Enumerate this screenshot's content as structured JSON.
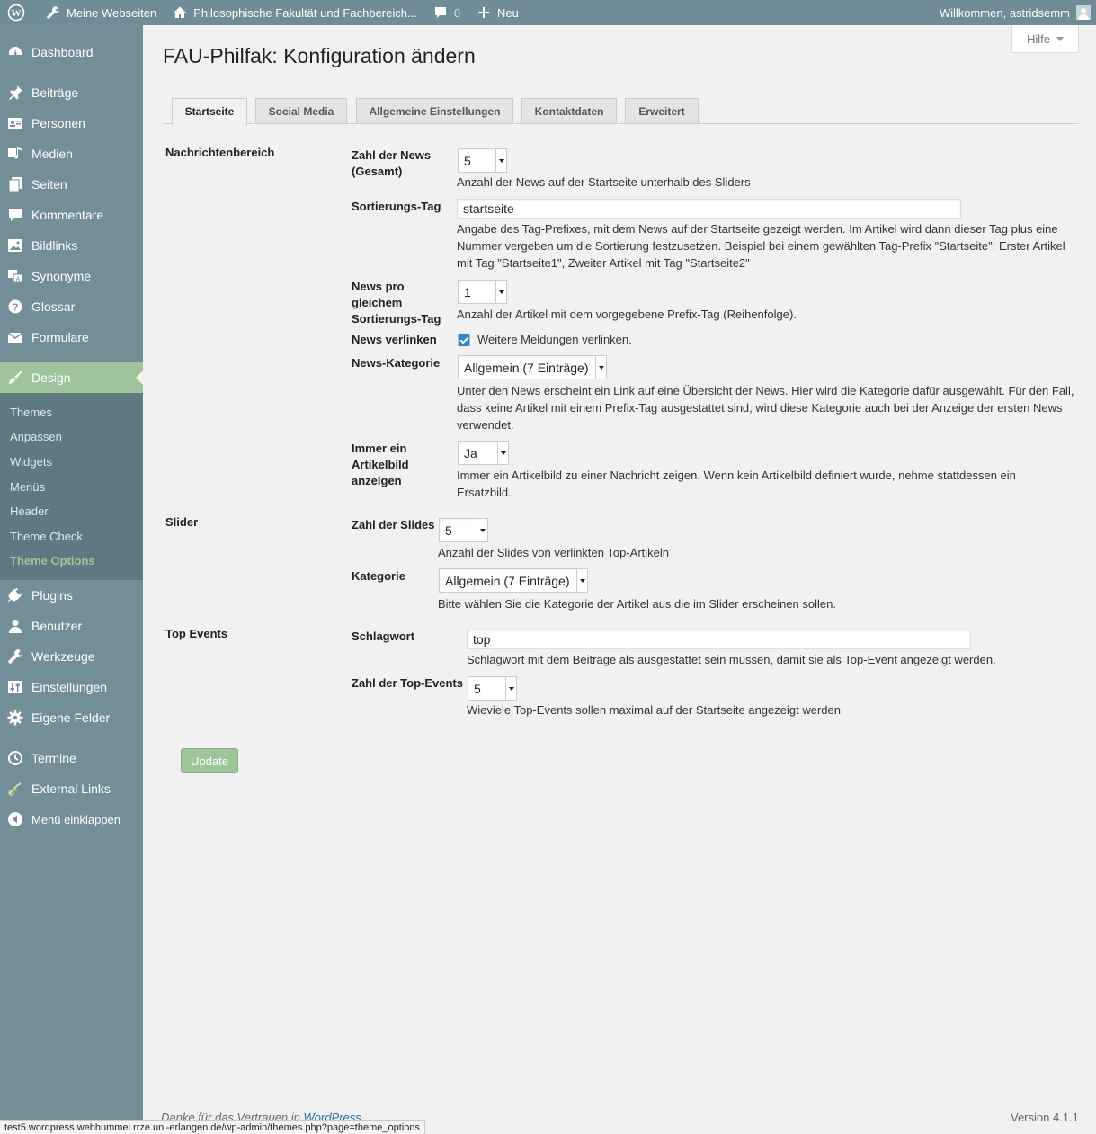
{
  "adminbar": {
    "my_sites": "Meine Webseiten",
    "site_name": "Philosophische Fakultät und Fachbereich...",
    "comments_count": "0",
    "new_label": "Neu",
    "greeting": "Willkommen, astridsemm"
  },
  "sidebar": {
    "items": [
      {
        "label": "Dashboard",
        "icon": "dashboard-icon"
      },
      {
        "label": "Beiträge",
        "icon": "pin-icon"
      },
      {
        "label": "Personen",
        "icon": "person-card-icon"
      },
      {
        "label": "Medien",
        "icon": "media-icon"
      },
      {
        "label": "Seiten",
        "icon": "pages-icon"
      },
      {
        "label": "Kommentare",
        "icon": "comment-icon"
      },
      {
        "label": "Bildlinks",
        "icon": "image-icon"
      },
      {
        "label": "Synonyme",
        "icon": "translate-icon"
      },
      {
        "label": "Glossar",
        "icon": "help-icon"
      },
      {
        "label": "Formulare",
        "icon": "mail-icon"
      },
      {
        "label": "Design",
        "icon": "brush-icon"
      },
      {
        "label": "Plugins",
        "icon": "plugin-icon"
      },
      {
        "label": "Benutzer",
        "icon": "user-icon"
      },
      {
        "label": "Werkzeuge",
        "icon": "wrench-icon"
      },
      {
        "label": "Einstellungen",
        "icon": "settings-sliders-icon"
      },
      {
        "label": "Eigene Felder",
        "icon": "gear-icon"
      },
      {
        "label": "Termine",
        "icon": "clock-icon"
      },
      {
        "label": "External Links",
        "icon": "chain-link-icon"
      },
      {
        "label": "Menü einklappen",
        "icon": "collapse-icon"
      }
    ],
    "submenu": [
      "Themes",
      "Anpassen",
      "Widgets",
      "Menüs",
      "Header",
      "Theme Check",
      "Theme Options"
    ],
    "current_item": "Design",
    "current_subitem": "Theme Options"
  },
  "help_label": "Hilfe",
  "page_title": "FAU-Philfak: Konfiguration ändern",
  "tabs": [
    "Startseite",
    "Social Media",
    "Allgemeine Einstellungen",
    "Kontaktdaten",
    "Erweitert"
  ],
  "active_tab": "Startseite",
  "sections": {
    "news": {
      "title": "Nachrichtenbereich",
      "zahl_news": {
        "label": "Zahl der News (Gesamt)",
        "value": "5",
        "desc": "Anzahl der News auf der Startseite unterhalb des Sliders"
      },
      "sortierungs_tag": {
        "label": "Sortierungs-Tag",
        "value": "startseite",
        "desc": "Angabe des Tag-Prefixes, mit dem News auf der Startseite gezeigt werden. Im Artikel wird dann dieser Tag plus eine Nummer vergeben um die Sortierung festzusetzen. Beispiel bei einem gewählten Tag-Prefix \"Startseite\": Erster Artikel mit Tag \"Startseite1\", Zweiter Artikel mit Tag \"Startseite2\""
      },
      "news_pro_tag": {
        "label": "News pro gleichem Sortierungs-Tag",
        "value": "1",
        "desc": "Anzahl der Artikel mit dem vorgegebene Prefix-Tag (Reihenfolge)."
      },
      "news_verlinken": {
        "label": "News verlinken",
        "checked": true,
        "checkbox_label": "Weitere Meldungen verlinken."
      },
      "news_kategorie": {
        "label": "News-Kategorie",
        "value": "Allgemein (7 Einträge)",
        "desc": "Unter den News erscheint ein Link auf eine Übersicht der News. Hier wird die Kategorie dafür ausgewählt. Für den Fall, dass keine Artikel mit einem Prefix-Tag ausgestattet sind, wird diese Kategorie auch bei der Anzeige der ersten News verwendet."
      },
      "artikelbild": {
        "label": "Immer ein Artikelbild anzeigen",
        "value": "Ja",
        "desc": "Immer ein Artikelbild zu einer Nachricht zeigen. Wenn kein Artikelbild definiert wurde, nehme stattdessen ein Ersatzbild."
      }
    },
    "slider": {
      "title": "Slider",
      "zahl_slides": {
        "label": "Zahl der Slides",
        "value": "5",
        "desc": "Anzahl der Slides von verlinkten Top-Artikeln"
      },
      "kategorie": {
        "label": "Kategorie",
        "value": "Allgemein (7 Einträge)",
        "desc": "Bitte wählen Sie die Kategorie der Artikel aus die im Slider erscheinen sollen."
      }
    },
    "top_events": {
      "title": "Top Events",
      "schlagwort": {
        "label": "Schlagwort",
        "value": "top",
        "desc": "Schlagwort mit dem Beiträge als ausgestattet sein müssen, damit sie als Top-Event angezeigt werden."
      },
      "zahl_events": {
        "label": "Zahl der Top-Events",
        "value": "5",
        "desc": "Wieviele Top-Events sollen maximal auf der Startseite angezeigt werden"
      }
    }
  },
  "update_label": "Update",
  "footer": {
    "thanks_text": "Danke für das Vertrauen in ",
    "wp_link": "WordPress",
    "thanks_suffix": ".",
    "version": "Version 4.1.1"
  },
  "status_url": "test5.wordpress.webhummel.rrze.uni-erlangen.de/wp-admin/themes.php?page=theme_options",
  "colors": {
    "adminbar_bg": "#708c96",
    "sidebar_bg": "#738e97",
    "submenu_bg": "#5f7983",
    "accent": "#9fc49b",
    "checkbox": "#2e86c9"
  }
}
